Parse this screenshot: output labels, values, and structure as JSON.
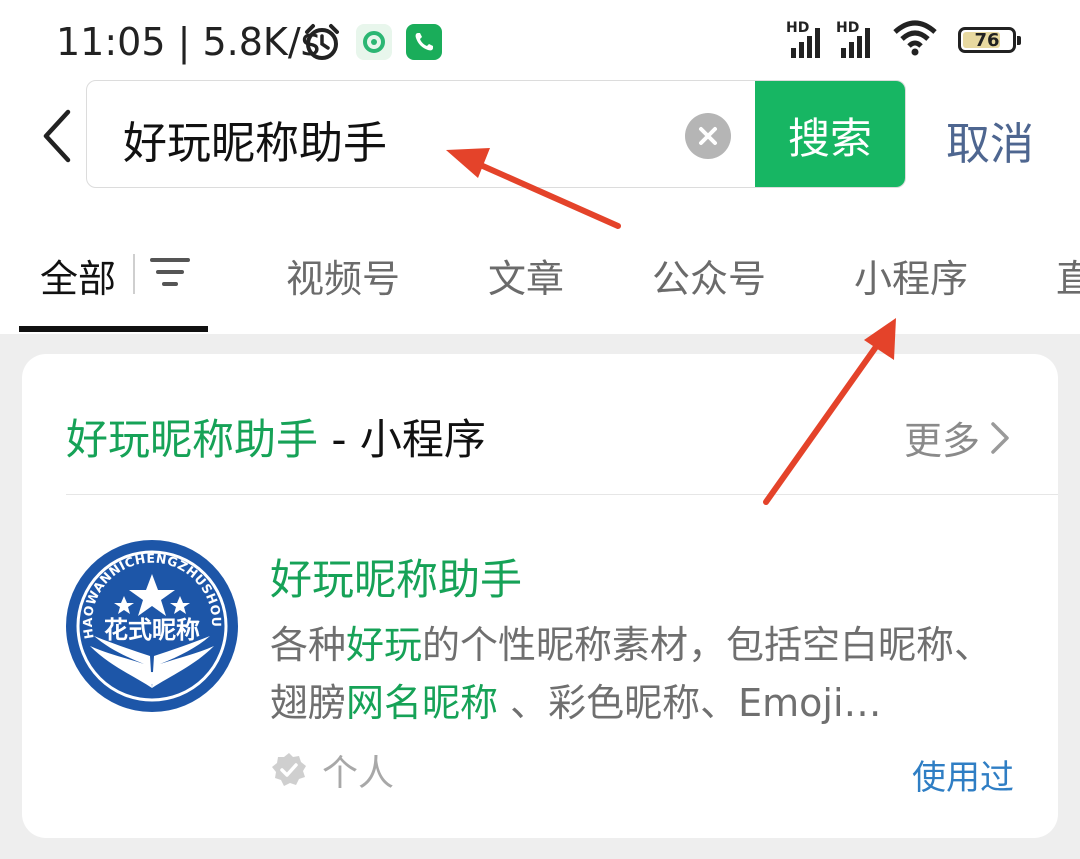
{
  "status_bar": {
    "time": "11:05 | 5.8K/s",
    "battery": "76",
    "hd1": "HD",
    "hd2": "HD"
  },
  "search": {
    "query": "好玩昵称助手",
    "search_button": "搜索",
    "cancel": "取消"
  },
  "tabs": [
    {
      "label": "全部"
    },
    {
      "label": "视频号"
    },
    {
      "label": "文章"
    },
    {
      "label": "公众号"
    },
    {
      "label": "小程序"
    },
    {
      "label": "直"
    }
  ],
  "card": {
    "title_highlight": "好玩昵称助手",
    "title_rest": " - 小程序",
    "more": "更多",
    "result": {
      "name": "好玩昵称助手",
      "desc_1": "各种",
      "desc_hl1": "好玩",
      "desc_2": "的个性昵称素材，包括空白昵称、翅膀",
      "desc_hl2": "网名昵称",
      "desc_3": " 、彩色昵称、Emoji…",
      "type": "个人",
      "used": "使用过",
      "logo_text": "花式昵称",
      "logo_ring_text": "HAOWANNICHENGZHUSHOU"
    }
  },
  "colors": {
    "accent_green": "#17b663",
    "highlight_green": "#16a257",
    "link_blue": "#2f7ec4",
    "annotation_red": "#e4432a",
    "logo_blue": "#1d56a8"
  }
}
